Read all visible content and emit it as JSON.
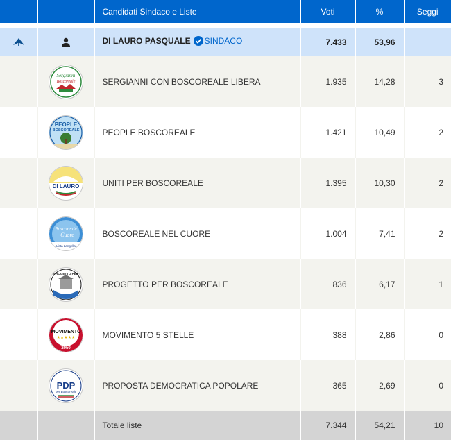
{
  "header": {
    "col_candidates": "Candidati Sindaco e Liste",
    "col_votes": "Voti",
    "col_percent": "%",
    "col_seats": "Seggi"
  },
  "sindaco": {
    "name": "DI LAURO PASQUALE",
    "tag": "SINDACO",
    "votes": "7.433",
    "percent": "53,96"
  },
  "lists": [
    {
      "name": "SERGIANNI CON BOSCOREALE LIBERA",
      "votes": "1.935",
      "percent": "14,28",
      "seats": "3",
      "logo_text": "Sergianni Boscoreale"
    },
    {
      "name": "PEOPLE BOSCOREALE",
      "votes": "1.421",
      "percent": "10,49",
      "seats": "2",
      "logo_text": "PEOPLE BOSCOREALE"
    },
    {
      "name": "UNITI PER BOSCOREALE",
      "votes": "1.395",
      "percent": "10,30",
      "seats": "2",
      "logo_text": "DI LAURO"
    },
    {
      "name": "BOSCOREALE NEL CUORE",
      "votes": "1.004",
      "percent": "7,41",
      "seats": "2",
      "logo_text": "Boscoreale Cuore"
    },
    {
      "name": "PROGETTO PER BOSCOREALE",
      "votes": "836",
      "percent": "6,17",
      "seats": "1",
      "logo_text": "PROGETTO PER BOSCOREALE"
    },
    {
      "name": "MOVIMENTO 5 STELLE",
      "votes": "388",
      "percent": "2,86",
      "seats": "0",
      "logo_text": "MOVIMENTO 2050"
    },
    {
      "name": "PROPOSTA DEMOCRATICA POPOLARE",
      "votes": "365",
      "percent": "2,69",
      "seats": "0",
      "logo_text": "PDP per Boscoreale"
    }
  ],
  "total": {
    "label": "Totale liste",
    "votes": "7.344",
    "percent": "54,21",
    "seats": "10"
  },
  "colors": {
    "header_bg": "#0066cc",
    "sindaco_bg": "#cfe3fa",
    "row_alt_bg": "#f3f3ee",
    "total_bg": "#d4d4d4",
    "accent": "#0066cc"
  }
}
